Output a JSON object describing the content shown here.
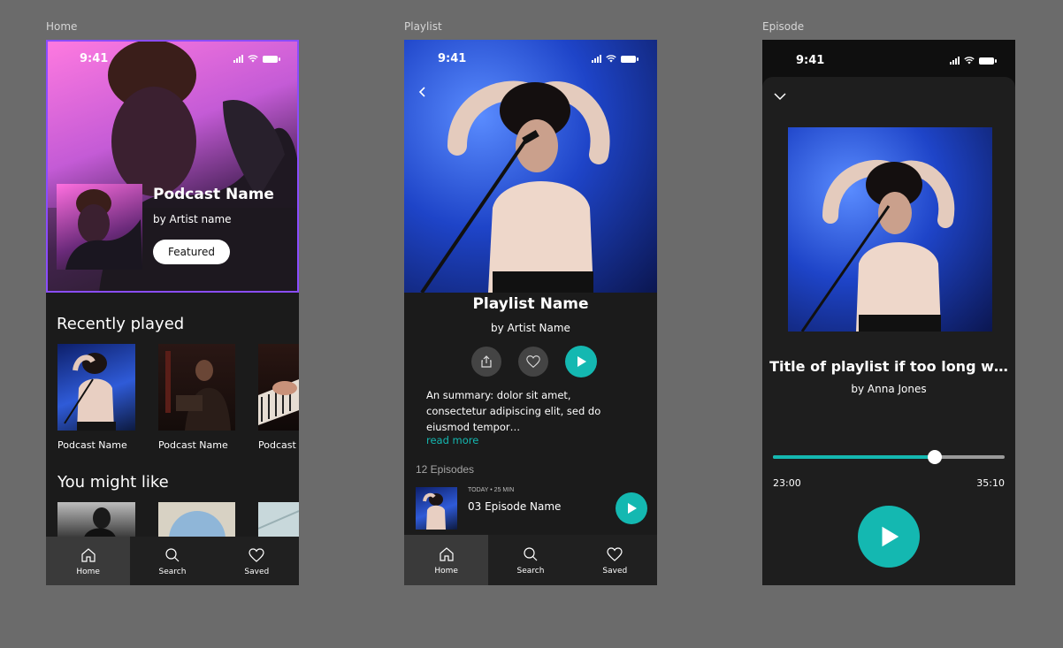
{
  "frames": {
    "home": "Home",
    "playlist": "Playlist",
    "episode": "Episode"
  },
  "status_time": "9:41",
  "home": {
    "hero": {
      "title": "Podcast Name",
      "artist": "by Artist name",
      "featured_label": "Featured"
    },
    "recently_played": {
      "title": "Recently played",
      "items": [
        "Podcast Name",
        "Podcast Name",
        "Podcast Name"
      ]
    },
    "you_might_like": {
      "title": "You might like"
    }
  },
  "playlist": {
    "title": "Playlist Name",
    "artist": "by Artist Name",
    "summary": "An summary:  dolor sit amet, consectetur adipiscing elit, sed do eiusmod tempor…",
    "read_more": "read more",
    "episodes_count": "12 Episodes",
    "episode": {
      "meta": "TODAY • 25 MIN",
      "title": "03 Episode Name"
    }
  },
  "episode": {
    "title": "Title of playlist if too long w…",
    "artist": "by Anna Jones",
    "elapsed": "23:00",
    "duration": "35:10",
    "progress": 0.7
  },
  "tabs": [
    "Home",
    "Search",
    "Saved"
  ],
  "colors": {
    "accent": "#14b8b1",
    "selection": "#8a4dff",
    "background": "#1b1b1b",
    "canvas": "#6b6b6b"
  }
}
